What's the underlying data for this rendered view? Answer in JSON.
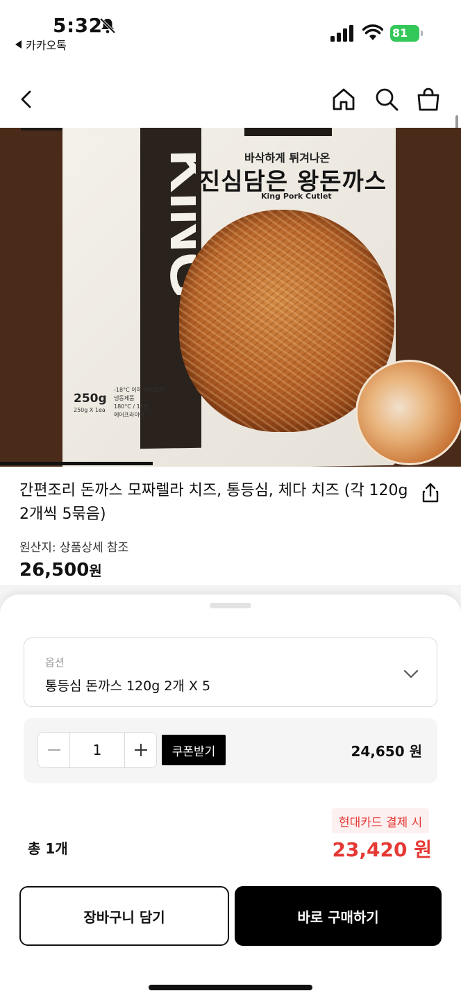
{
  "status_bar": {
    "time": "5:32",
    "back_app": "카카오톡",
    "battery": "81"
  },
  "nav": {
    "icons": [
      "back-arrow-icon",
      "home-icon",
      "search-icon",
      "shopping-bag-icon"
    ]
  },
  "product_image": {
    "sub_title": "바삭하게 튀겨나온",
    "title": "진심담은 왕돈까스",
    "english": "King Pork Cutlet",
    "brand": "KING",
    "weight": "250g",
    "weight_sub": "250g X 1ea",
    "storage_line1": "-18°C 이하 냉동보관",
    "storage_line2": "냉동제품",
    "storage_line3": "180°C / 15분",
    "storage_line4": "에어프라이어"
  },
  "product": {
    "name": "간편조리 돈까스 모짜렐라 치즈, 통등심, 체다 치즈 (각 120g 2개씩 5묶음)",
    "origin": "원산지: 상품상세 참조",
    "price": "26,500",
    "price_unit": "원"
  },
  "sheet": {
    "option_label": "옵션",
    "option_value": "통등심 돈까스 120g 2개 X 5",
    "quantity": "1",
    "coupon_label": "쿠폰받기",
    "item_price": "24,650 원",
    "card_badge": "현대카드 결제 시",
    "total_label": "총 1개",
    "total_price": "23,420 원",
    "cart_button": "장바구니 담기",
    "buy_button": "바로 구매하기"
  },
  "colors": {
    "accent_red": "#e53935",
    "battery_green": "#34c759",
    "image_bg": "#4a2a18"
  }
}
